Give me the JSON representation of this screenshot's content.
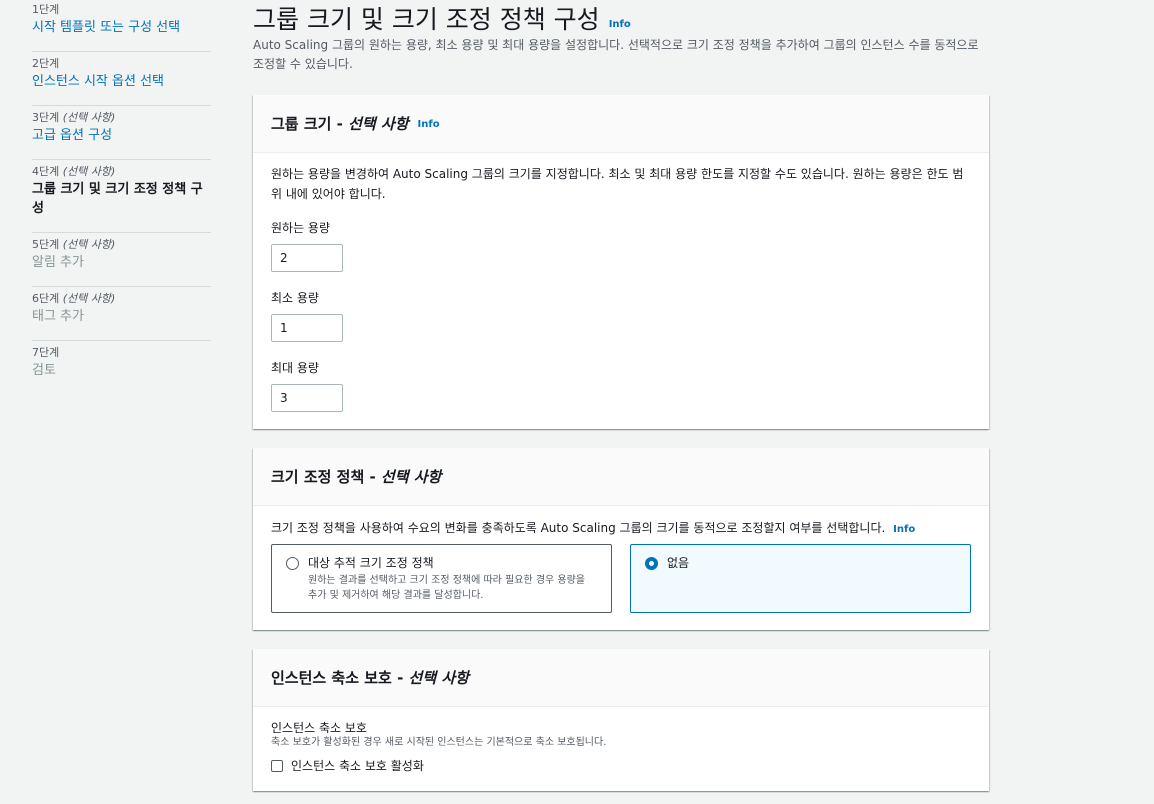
{
  "sidebar": {
    "steps": [
      {
        "num": "1단계",
        "optional": "",
        "title": "시작 템플릿 또는 구성 선택"
      },
      {
        "num": "2단계",
        "optional": "",
        "title": "인스턴스 시작 옵션 선택"
      },
      {
        "num": "3단계",
        "optional": "(선택 사항)",
        "title": "고급 옵션 구성"
      },
      {
        "num": "4단계",
        "optional": "(선택 사항)",
        "title": "그룹 크기 및 크기 조정 정책 구성"
      },
      {
        "num": "5단계",
        "optional": "(선택 사항)",
        "title": "알림 추가"
      },
      {
        "num": "6단계",
        "optional": "(선택 사항)",
        "title": "태그 추가"
      },
      {
        "num": "7단계",
        "optional": "",
        "title": "검토"
      }
    ]
  },
  "page": {
    "title": "그룹 크기 및 크기 조정 정책 구성",
    "info": "Info",
    "description": "Auto Scaling 그룹의 원하는 용량, 최소 용량 및 최대 용량을 설정합니다. 선택적으로 크기 조정 정책을 추가하여 그룹의 인스턴스 수를 동적으로 조정할 수 있습니다."
  },
  "group_size": {
    "title": "그룹 크기 - ",
    "title_optional": "선택 사항",
    "info": "Info",
    "description": "원하는 용량을 변경하여 Auto Scaling 그룹의 크기를 지정합니다. 최소 및 최대 용량 한도를 지정할 수도 있습니다. 원하는 용량은 한도 범위 내에 있어야 합니다.",
    "desired_label": "원하는 용량",
    "desired_value": "2",
    "min_label": "최소 용량",
    "min_value": "1",
    "max_label": "최대 용량",
    "max_value": "3"
  },
  "scaling_policy": {
    "title": "크기 조정 정책 - ",
    "title_optional": "선택 사항",
    "description": "크기 조정 정책을 사용하여 수요의 변화를 충족하도록 Auto Scaling 그룹의 크기를 동적으로 조정할지 여부를 선택합니다.",
    "info": "Info",
    "option_target_title": "대상 추적 크기 조정 정책",
    "option_target_desc": "원하는 결과를 선택하고 크기 조정 정책에 따라 필요한 경우 용량을 추가 및 제거하여 해당 결과를 달성합니다.",
    "option_none_title": "없음"
  },
  "scale_in": {
    "title": "인스턴스 축소 보호 - ",
    "title_optional": "선택 사항",
    "label": "인스턴스 축소 보호",
    "description": "축소 보호가 활성화된 경우 새로 시작된 인스턴스는 기본적으로 축소 보호됩니다.",
    "checkbox_label": "인스턴스 축소 보호 활성화"
  }
}
